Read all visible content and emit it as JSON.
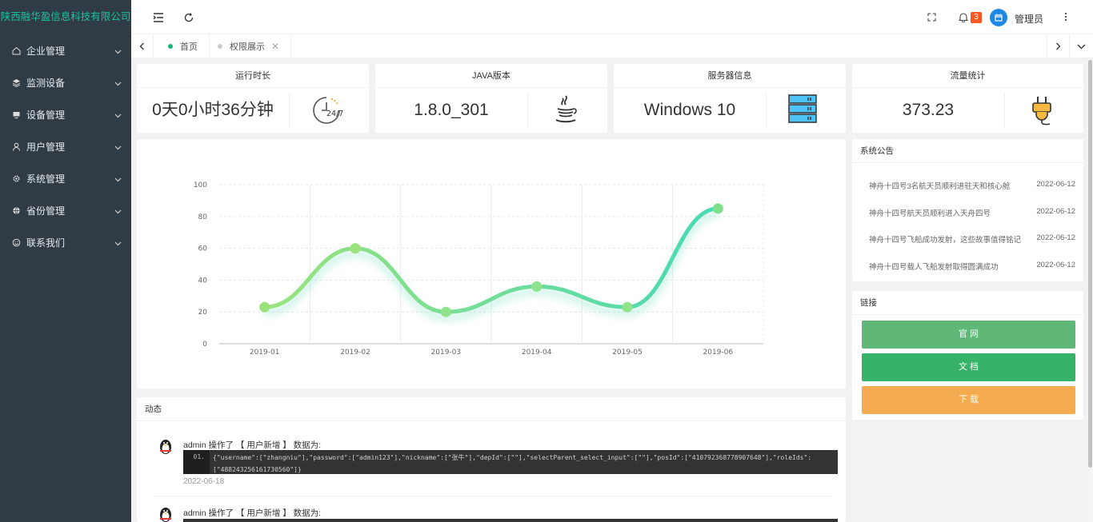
{
  "brand": {
    "title": "陕西融华盈信息科技有限公司",
    "color": "#17c4a0"
  },
  "sidebar": {
    "items": [
      {
        "label": "企业管理",
        "icon": "home-icon"
      },
      {
        "label": "监测设备",
        "icon": "layers-icon"
      },
      {
        "label": "设备管理",
        "icon": "monitor-icon"
      },
      {
        "label": "用户管理",
        "icon": "user-icon"
      },
      {
        "label": "系统管理",
        "icon": "gear-icon"
      },
      {
        "label": "省份管理",
        "icon": "globe-icon"
      },
      {
        "label": "联系我们",
        "icon": "smile-icon"
      }
    ]
  },
  "header": {
    "notification_count": "3",
    "username": "管理员"
  },
  "tabs": [
    {
      "label": "首页",
      "active": true
    },
    {
      "label": "权限展示",
      "active": false,
      "closable": true
    }
  ],
  "stats": [
    {
      "title": "运行时长",
      "value": "0天0小时36分钟",
      "icon": "clock-24-7-icon",
      "icon_text": "24/7"
    },
    {
      "title": "JAVA版本",
      "value": "1.8.0_301",
      "icon": "java-icon"
    },
    {
      "title": "服务器信息",
      "value": "Windows 10",
      "icon": "server-icon"
    },
    {
      "title": "流量统计",
      "value": "373.23",
      "icon": "plug-icon"
    }
  ],
  "chart_data": {
    "type": "line",
    "categories": [
      "2019-01",
      "2019-02",
      "2019-03",
      "2019-04",
      "2019-05",
      "2019-06"
    ],
    "values": [
      23,
      60,
      20,
      36,
      23,
      85
    ],
    "ylim": [
      0,
      100
    ],
    "yticks": [
      "0",
      "20",
      "40",
      "60",
      "80",
      "100"
    ],
    "smooth": true,
    "grid": true,
    "colors": {
      "start": "#9be27d",
      "end": "#48d9b4"
    }
  },
  "notices": {
    "title": "系统公告",
    "items": [
      {
        "text": "神舟十四号3名航天员顺利进驻天和核心舱",
        "date": "2022-06-12"
      },
      {
        "text": "神舟十四号航天员顺利进入天舟四号",
        "date": "2022-06-12"
      },
      {
        "text": "神舟十四号飞船成功发射，这些故事值得铭记",
        "date": "2022-06-12"
      },
      {
        "text": "神舟十四号载人飞船发射取得圆满成功",
        "date": "2022-06-12"
      }
    ]
  },
  "links": {
    "title": "链接",
    "items": [
      {
        "label": "官 网",
        "color": "#5fb878"
      },
      {
        "label": "文 档",
        "color": "#36b368"
      },
      {
        "label": "下 载",
        "color": "#f5ab4f"
      }
    ]
  },
  "activity": {
    "title": "动态",
    "items": [
      {
        "text": "admin 操作了 【 用户新增 】 数据为:",
        "line_no": "01.",
        "code": "{\"username\":[\"zhangniu\"],\"password\":[\"admin123\"],\"nickname\":[\"张牛\"],\"depId\":[\"\"],\"selectParent_select_input\":[\"\"],\"posId\":[\"410792368778907648\"],\"roleIds\":[\"488243256161730560\"]}",
        "date": "2022-06-18"
      },
      {
        "text": "admin 操作了 【 用户新增 】 数据为:"
      }
    ]
  }
}
